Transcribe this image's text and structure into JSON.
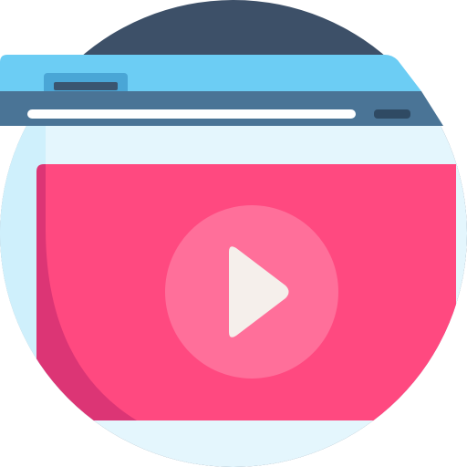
{
  "icon": {
    "name": "video-player-browser-icon",
    "colors": {
      "background_circle": "#3D5068",
      "title_bar": "#6CCDF4",
      "tab": "#4AA6D6",
      "tab_slot": "#3A5570",
      "address_bar": "#4A7496",
      "address_field": "#FFFFFF",
      "address_button": "#2F4A63",
      "page_light": "#E4F6FD",
      "page_side": "#CFF0FC",
      "video_area": "#FF4980",
      "video_shadow": "#DC3575",
      "play_circle": "#FF6F9A",
      "play_triangle": "#F5EFEB"
    }
  }
}
